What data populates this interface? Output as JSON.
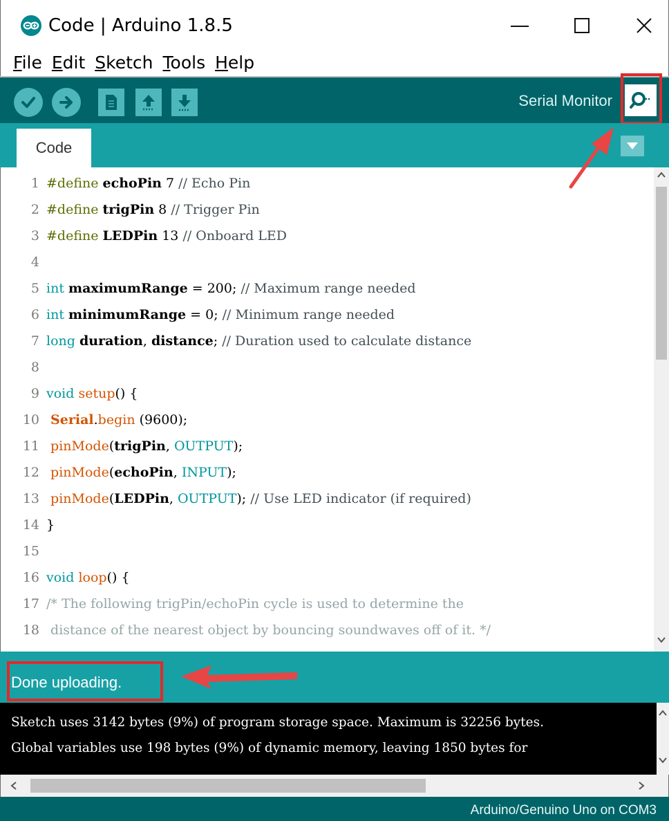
{
  "window": {
    "title": "Code | Arduino 1.8.5",
    "controls": {
      "minimize": "minimize-icon",
      "maximize": "maximize-icon",
      "close": "close-icon"
    }
  },
  "menu": [
    {
      "accel": "F",
      "rest": "ile"
    },
    {
      "accel": "E",
      "rest": "dit"
    },
    {
      "accel": "S",
      "rest": "ketch"
    },
    {
      "accel": "T",
      "rest": "ools"
    },
    {
      "accel": "H",
      "rest": "elp"
    }
  ],
  "toolbar": {
    "serial_monitor_label": "Serial Monitor",
    "icons": [
      "check-icon",
      "arrow-right-icon",
      "new-file-icon",
      "arrow-up-icon",
      "arrow-down-icon",
      "magnifier-icon"
    ]
  },
  "tabs": [
    {
      "label": "Code",
      "active": true
    }
  ],
  "editor": {
    "lines": [
      {
        "n": "1",
        "text": "#define echoPin 7 // Echo Pin"
      },
      {
        "n": "2",
        "text": "#define trigPin 8 // Trigger Pin"
      },
      {
        "n": "3",
        "text": "#define LEDPin 13 // Onboard LED"
      },
      {
        "n": "4",
        "text": ""
      },
      {
        "n": "5",
        "text": "int maximumRange = 200; // Maximum range needed"
      },
      {
        "n": "6",
        "text": "int minimumRange = 0; // Minimum range needed"
      },
      {
        "n": "7",
        "text": "long duration, distance; // Duration used to calculate distance"
      },
      {
        "n": "8",
        "text": ""
      },
      {
        "n": "9",
        "text": "void setup() {"
      },
      {
        "n": "10",
        "text": " Serial.begin (9600);"
      },
      {
        "n": "11",
        "text": " pinMode(trigPin, OUTPUT);"
      },
      {
        "n": "12",
        "text": " pinMode(echoPin, INPUT);"
      },
      {
        "n": "13",
        "text": " pinMode(LEDPin, OUTPUT); // Use LED indicator (if required)"
      },
      {
        "n": "14",
        "text": "}"
      },
      {
        "n": "15",
        "text": ""
      },
      {
        "n": "16",
        "text": "void loop() {"
      },
      {
        "n": "17",
        "text": "/* The following trigPin/echoPin cycle is used to determine the"
      },
      {
        "n": "18",
        "text": " distance of the nearest object by bouncing soundwaves off of it. */"
      }
    ]
  },
  "status": {
    "message": "Done uploading."
  },
  "console": {
    "lines": [
      "Sketch uses 3142 bytes (9%) of program storage space. Maximum is 32256 bytes.",
      "Global variables use 198 bytes (9%) of dynamic memory, leaving 1850 bytes for"
    ]
  },
  "footer": {
    "board": "Arduino/Genuino Uno on COM3"
  },
  "colors": {
    "toolbar_bg": "#006468",
    "tabbar_bg": "#17a1a5",
    "button_bg": "#4db7bb",
    "highlight": "#e02a2a"
  }
}
